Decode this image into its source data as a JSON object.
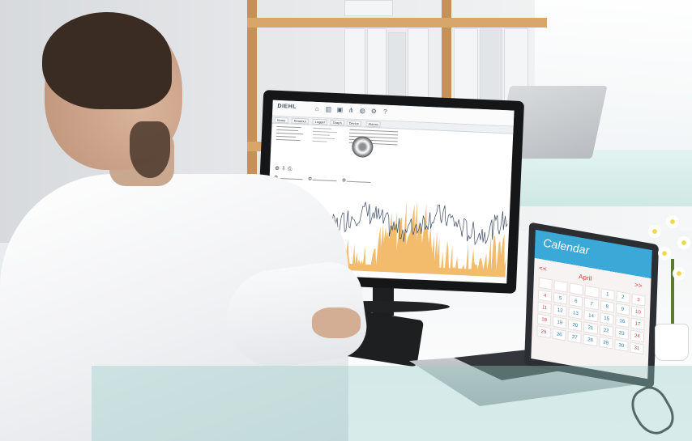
{
  "monitor_app": {
    "logo": "DIEHL",
    "toolbar_icons": [
      "home-icon",
      "chart-icon",
      "device-icon",
      "network-icon",
      "alarm-icon",
      "settings-icon",
      "help-icon"
    ],
    "tabs": [
      "Home",
      "Readout",
      "Logger",
      "Graph",
      "Device",
      "Alarms"
    ],
    "chart_fill_color": "#f2b55c",
    "chart_line_color": "#3b4a63"
  },
  "laptop_calendar": {
    "title": "Calendar",
    "month": "April",
    "nav_prev": "<<",
    "nav_next": ">>",
    "days": [
      "",
      "",
      "",
      "",
      "1",
      "2",
      "3",
      "4",
      "5",
      "6",
      "7",
      "8",
      "9",
      "10",
      "11",
      "12",
      "13",
      "14",
      "15",
      "16",
      "17",
      "18",
      "19",
      "20",
      "21",
      "22",
      "23",
      "24",
      "25",
      "26",
      "27",
      "28",
      "29",
      "30",
      "31"
    ],
    "accent_color": "#d43b3b",
    "header_color": "#3aa9d8"
  }
}
